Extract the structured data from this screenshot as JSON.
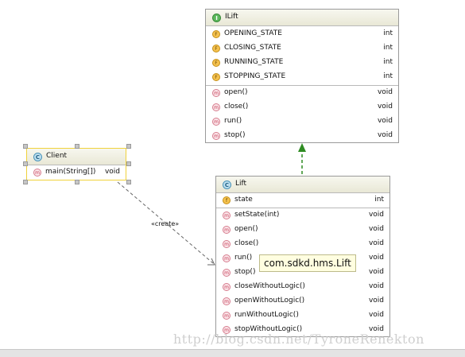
{
  "interface_ilift": {
    "name": "ILift",
    "icon_letter": "I",
    "fields": [
      {
        "name": "OPENING_STATE",
        "type": "int"
      },
      {
        "name": "CLOSING_STATE",
        "type": "int"
      },
      {
        "name": "RUNNING_STATE",
        "type": "int"
      },
      {
        "name": "STOPPING_STATE",
        "type": "int"
      }
    ],
    "methods": [
      {
        "name": "open()",
        "type": "void"
      },
      {
        "name": "close()",
        "type": "void"
      },
      {
        "name": "run()",
        "type": "void"
      },
      {
        "name": "stop()",
        "type": "void"
      }
    ]
  },
  "class_client": {
    "name": "Client",
    "icon_letter": "C",
    "methods": [
      {
        "name": "main(String[])",
        "type": "void"
      }
    ]
  },
  "class_lift": {
    "name": "Lift",
    "icon_letter": "C",
    "fields": [
      {
        "name": "state",
        "type": "int"
      }
    ],
    "methods": [
      {
        "name": "setState(int)",
        "type": "void"
      },
      {
        "name": "open()",
        "type": "void"
      },
      {
        "name": "close()",
        "type": "void"
      },
      {
        "name": "run()",
        "type": "void"
      },
      {
        "name": "stop()",
        "type": "void"
      },
      {
        "name": "closeWithoutLogic()",
        "type": "void"
      },
      {
        "name": "openWithoutLogic()",
        "type": "void"
      },
      {
        "name": "runWithoutLogic()",
        "type": "void"
      },
      {
        "name": "stopWithoutLogic()",
        "type": "void"
      }
    ]
  },
  "relation_label": "«create»",
  "tooltip": "com.sdkd.hms.Lift",
  "watermark": "http://blog.csdn.net/TyroneRenekton",
  "colors": {
    "realization_arrow": "#2e8b22",
    "dependency_arrow": "#666666",
    "selection": "#f0d23c"
  }
}
